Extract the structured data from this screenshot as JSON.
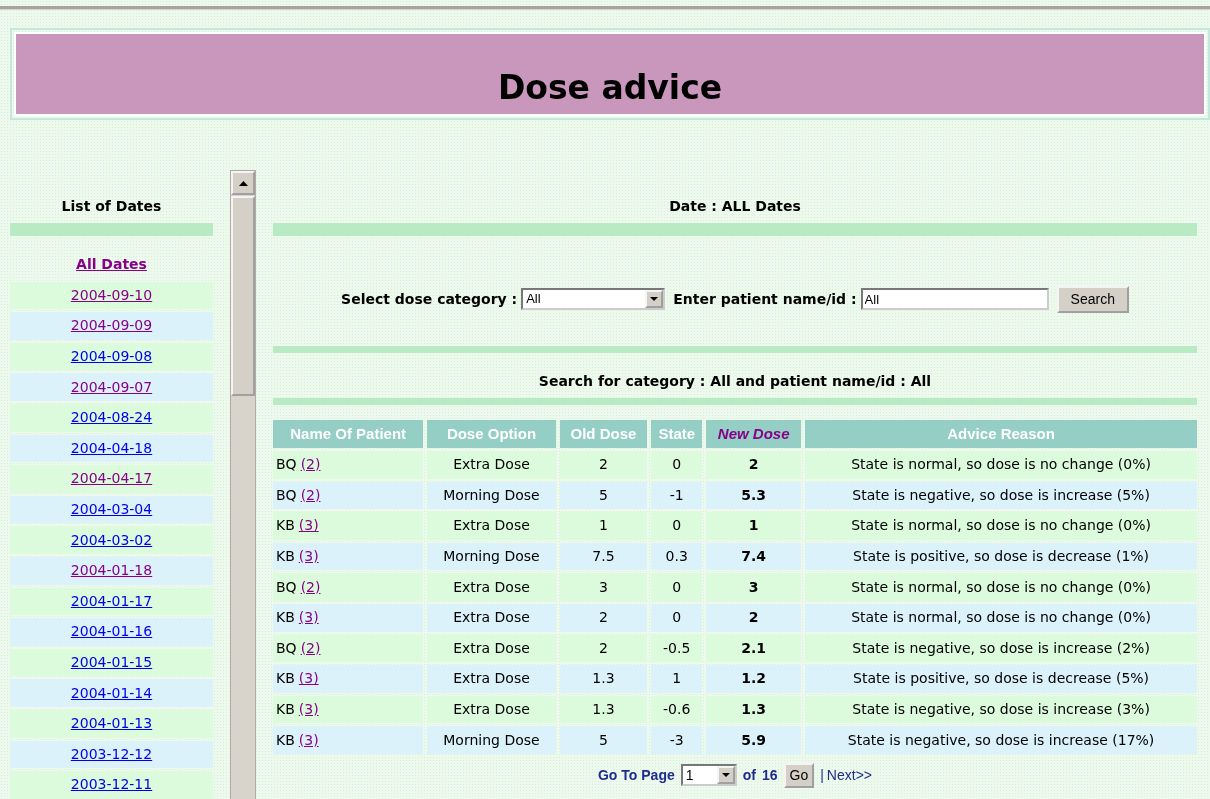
{
  "header": {
    "title": "Dose advice"
  },
  "sidebar": {
    "title": "List of Dates",
    "items": [
      {
        "label": "All Dates",
        "selected": true,
        "visited": true
      },
      {
        "label": "2004-09-10",
        "selected": false,
        "visited": true
      },
      {
        "label": "2004-09-09",
        "selected": false,
        "visited": true
      },
      {
        "label": "2004-09-08",
        "selected": false,
        "visited": false
      },
      {
        "label": "2004-09-07",
        "selected": false,
        "visited": true
      },
      {
        "label": "2004-08-24",
        "selected": false,
        "visited": false
      },
      {
        "label": "2004-04-18",
        "selected": false,
        "visited": false
      },
      {
        "label": "2004-04-17",
        "selected": false,
        "visited": true
      },
      {
        "label": "2004-03-04",
        "selected": false,
        "visited": false
      },
      {
        "label": "2004-03-02",
        "selected": false,
        "visited": false
      },
      {
        "label": "2004-01-18",
        "selected": false,
        "visited": true
      },
      {
        "label": "2004-01-17",
        "selected": false,
        "visited": false
      },
      {
        "label": "2004-01-16",
        "selected": false,
        "visited": false
      },
      {
        "label": "2004-01-15",
        "selected": false,
        "visited": false
      },
      {
        "label": "2004-01-14",
        "selected": false,
        "visited": false
      },
      {
        "label": "2004-01-13",
        "selected": false,
        "visited": false
      },
      {
        "label": "2003-12-12",
        "selected": false,
        "visited": false
      },
      {
        "label": "2003-12-11",
        "selected": false,
        "visited": false
      }
    ]
  },
  "main": {
    "date_heading": "Date : ALL Dates",
    "filter": {
      "category_label": "Select dose category :",
      "category_value": "All",
      "patient_label": "Enter patient name/id :",
      "patient_value": "All",
      "search_button": "Search"
    },
    "result_heading": "Search for category : All and patient name/id : All",
    "table": {
      "columns": [
        {
          "label": "Name Of Patient",
          "sorted": false
        },
        {
          "label": "Dose Option",
          "sorted": false
        },
        {
          "label": "Old Dose",
          "sorted": false
        },
        {
          "label": "State",
          "sorted": false
        },
        {
          "label": "New Dose",
          "sorted": true
        },
        {
          "label": "Advice Reason",
          "sorted": false
        }
      ],
      "rows": [
        {
          "patient": "BQ",
          "count": "(2)",
          "dose_option": "Extra Dose",
          "old_dose": "2",
          "state": "0",
          "new_dose": "2",
          "advice_reason": "State is normal, so dose is no change (0%)"
        },
        {
          "patient": "BQ",
          "count": "(2)",
          "dose_option": "Morning Dose",
          "old_dose": "5",
          "state": "-1",
          "new_dose": "5.3",
          "advice_reason": "State is negative, so dose is increase (5%)"
        },
        {
          "patient": "KB",
          "count": "(3)",
          "dose_option": "Extra Dose",
          "old_dose": "1",
          "state": "0",
          "new_dose": "1",
          "advice_reason": "State is normal, so dose is no change (0%)"
        },
        {
          "patient": "KB",
          "count": "(3)",
          "dose_option": "Morning Dose",
          "old_dose": "7.5",
          "state": "0.3",
          "new_dose": "7.4",
          "advice_reason": "State is positive, so dose is decrease (1%)"
        },
        {
          "patient": "BQ",
          "count": "(2)",
          "dose_option": "Extra Dose",
          "old_dose": "3",
          "state": "0",
          "new_dose": "3",
          "advice_reason": "State is normal, so dose is no change (0%)"
        },
        {
          "patient": "KB",
          "count": "(3)",
          "dose_option": "Extra Dose",
          "old_dose": "2",
          "state": "0",
          "new_dose": "2",
          "advice_reason": "State is normal, so dose is no change (0%)"
        },
        {
          "patient": "BQ",
          "count": "(2)",
          "dose_option": "Extra Dose",
          "old_dose": "2",
          "state": "-0.5",
          "new_dose": "2.1",
          "advice_reason": "State is negative, so dose is increase (2%)"
        },
        {
          "patient": "KB",
          "count": "(3)",
          "dose_option": "Extra Dose",
          "old_dose": "1.3",
          "state": "1",
          "new_dose": "1.2",
          "advice_reason": "State is positive, so dose is decrease (5%)"
        },
        {
          "patient": "KB",
          "count": "(3)",
          "dose_option": "Extra Dose",
          "old_dose": "1.3",
          "state": "-0.6",
          "new_dose": "1.3",
          "advice_reason": "State is negative, so dose is increase (3%)"
        },
        {
          "patient": "KB",
          "count": "(3)",
          "dose_option": "Morning Dose",
          "old_dose": "5",
          "state": "-3",
          "new_dose": "5.9",
          "advice_reason": "State is negative, so dose is increase (17%)"
        }
      ]
    },
    "pager": {
      "label": "Go To Page",
      "page": "1",
      "of_label": "of",
      "total": "16",
      "go_button": "Go",
      "separator": "|",
      "next_link": "Next>>"
    }
  }
}
